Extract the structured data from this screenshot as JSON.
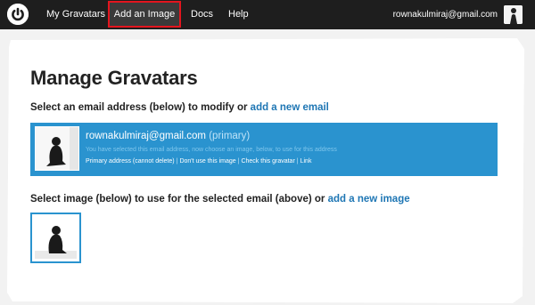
{
  "nav": {
    "items": [
      {
        "label": "My Gravatars"
      },
      {
        "label": "Add an Image"
      },
      {
        "label": "Docs"
      },
      {
        "label": "Help"
      }
    ],
    "user_email": "rownakulmiraj@gmail.com",
    "logo_icon": "gravatar-power-icon",
    "active_highlight_color": "#e3151e"
  },
  "page": {
    "title": "Manage Gravatars",
    "select_email_prefix": "Select an email address (below) to modify or ",
    "add_email_link": "add a new email",
    "select_image_prefix": "Select image (below) to use for the selected email (above) or ",
    "add_image_link": "add a new image"
  },
  "email_entry": {
    "address": "rownakulmiraj@gmail.com",
    "status": "(primary)",
    "note": "You have selected this email address, now choose an image, below, to use for this address",
    "actions": [
      "Primary address (cannot delete)",
      "Don't use this image",
      "Check this gravatar",
      "Link"
    ]
  },
  "colors": {
    "accent": "#2a93cf",
    "link": "#1e76b4",
    "topbar": "#1e1e1e"
  }
}
